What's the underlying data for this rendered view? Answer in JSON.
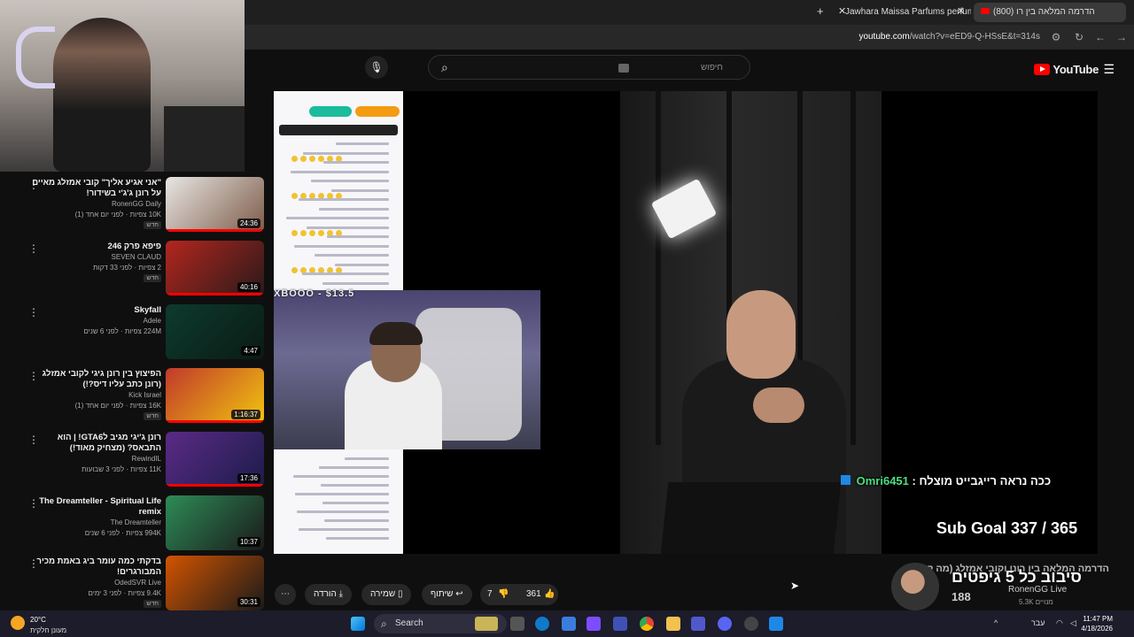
{
  "browser": {
    "tabs": [
      {
        "label": "(800) הדרמה המלאה בין רו"
      },
      {
        "label": "Jawhara Maissa Parfums perfum"
      }
    ],
    "url_domain": "youtube.com",
    "url_path": "/watch?v=eED9-Q-HSsE&t=314s"
  },
  "header": {
    "logo": "YouTube",
    "search_placeholder": "חיפוש"
  },
  "recommendations": [
    {
      "title": "\"אני אגיע אליך\" קובי אמזלג מאיים על רונן ג'ג'י בשידור!",
      "channel": "RonenGG Daily",
      "meta": "10K צפיות · לפני יום אחד (1)",
      "badge": "חדש",
      "duration": "24:36",
      "thumb_colors": [
        "#e8e6e3",
        "#7d5c4a"
      ]
    },
    {
      "title": "פיפא פרק 246",
      "channel": "SEVEN CLAUD",
      "meta": "2 צפיות · לפני 33 דקות",
      "badge": "חדש",
      "duration": "40:16",
      "thumb_colors": [
        "#b3261e",
        "#2a1a1a"
      ]
    },
    {
      "title": "Skyfall",
      "channel": "Adele",
      "meta": "224M צפיות · לפני 6 שנים",
      "badge": "",
      "duration": "4:47",
      "thumb_colors": [
        "#0d3b2e",
        "#0a1a14"
      ]
    },
    {
      "title": "הפיצוץ בין רונן גיגי לקובי אמזלג (רונן כתב עליו דיס?!)",
      "channel": "Kick Israel",
      "meta": "16K צפיות · לפני יום אחד (1)",
      "badge": "חדש",
      "duration": "1:16:37",
      "thumb_colors": [
        "#c0392b",
        "#f1c40f"
      ]
    },
    {
      "title": "רונן ג'יגי מגיב לGTA6! | הוא התבאס? (מצחיק מאוד!)",
      "channel": "RewindIL",
      "meta": "11K צפיות · לפני 3 שבועות",
      "badge": "",
      "duration": "17:36",
      "thumb_colors": [
        "#5b2a86",
        "#1c1c4a"
      ]
    },
    {
      "title": "The Dreamteller - Spiritual Life remix",
      "channel": "The Dreamteller",
      "meta": "994K צפיות · לפני 6 שנים",
      "badge": "",
      "duration": "10:37",
      "thumb_colors": [
        "#2e8b57",
        "#1a1a1a"
      ]
    },
    {
      "title": "בדקתי כמה עומר ביג באמת מכיר המבורגרים!",
      "channel": "OdedSVR Live",
      "meta": "9.4K צפיות · לפני 3 ימים",
      "badge": "חדש",
      "duration": "30:31",
      "thumb_colors": [
        "#d35400",
        "#1a1a1a"
      ]
    }
  ],
  "player": {
    "stream_counter": "XBOOO - $13.5",
    "chat_username": "Omri6451",
    "chat_text": ": ככה נראה רייגבייט מוצלח",
    "sub_goal": "Sub Goal 337 / 365"
  },
  "actions": {
    "likes": "361",
    "dislikes": "7",
    "share": "שיתוף",
    "save": "שמירה",
    "download": "הורדה"
  },
  "mini_overlay": {
    "title_fragment": "הדרמה המלאה בין רונן וקובי אמזלג (מה קרה?)",
    "headline": "סיבוב כל 5 גיפטים",
    "channel": "RonenGG Live",
    "count": "188",
    "subs": "5.3K מנויים"
  },
  "taskbar": {
    "weather_temp": "20°C",
    "weather_desc": "מעונן חלקית",
    "search": "Search",
    "lang": "עבר",
    "time": "11:47 PM",
    "date": "4/18/2026"
  },
  "colors": {
    "accent": "#ff0000",
    "chat_user": "#4ade80",
    "background": "#0f0f0f"
  }
}
